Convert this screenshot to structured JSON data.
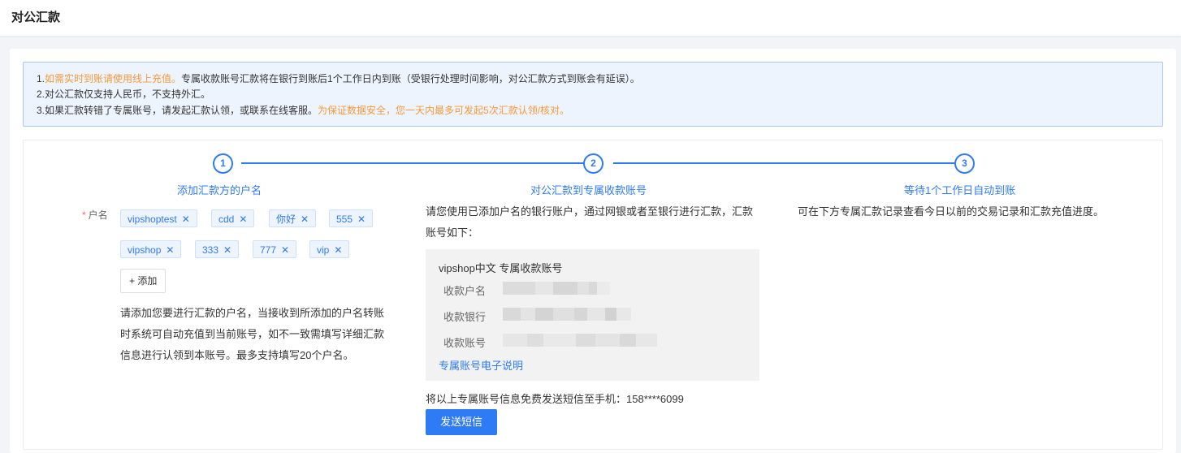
{
  "header": {
    "title": "对公汇款"
  },
  "notice": {
    "line1_prefix": "1.",
    "line1_highlight": "如需实时到账请使用线上充值。",
    "line1_rest": "专属收款账号汇款将在银行到账后1个工作日内到账（受银行处理时间影响，对公汇款方式到账会有延误）。",
    "line2": "2.对公汇款仅支持人民币，不支持外汇。",
    "line3_prefix": "3.如果汇款转错了专属账号，请发起汇款认领，或联系在线客服。",
    "line3_highlight": "为保证数据安全，您一天内最多可发起5次汇款认领/核对。",
    "highlight_color": "#f39a3a"
  },
  "steps": [
    {
      "number": "1",
      "title": "添加汇款方的户名"
    },
    {
      "number": "2",
      "title": "对公汇款到专属收款账号"
    },
    {
      "number": "3",
      "title": "等待1个工作日自动到账"
    }
  ],
  "step1": {
    "required_label": "户名",
    "tags": [
      "vipshoptest",
      "cdd",
      "你好",
      "555",
      "vipshop",
      "333",
      "777",
      "vip"
    ],
    "add_button": "+ 添加",
    "description_lines": [
      "请添加您要进行汇款的户名，当接收到所添加的户名转账",
      "时系统可自动充值到当前账号，如不一致需填写详细汇款",
      "信息进行认领到本账号。最多支持填写20个户名。"
    ]
  },
  "step2": {
    "description_lines": [
      "请您使用已添加户名的银行账户，通过网银或者至银行进行汇款，汇款",
      "账号如下："
    ],
    "account_box_title": "vipshop中文 专属收款账号",
    "account_labels": [
      "收款户名",
      "收款银行",
      "收款账号"
    ],
    "account_link": "专属账号电子说明",
    "sms_text": "将以上专属账号信息免费发送短信至手机：158****6099",
    "sms_button": "发送短信"
  },
  "step3": {
    "description": "可在下方专属汇款记录查看今日以前的交易记录和汇款充值进度。"
  },
  "accent_color": "#2f7bf5"
}
